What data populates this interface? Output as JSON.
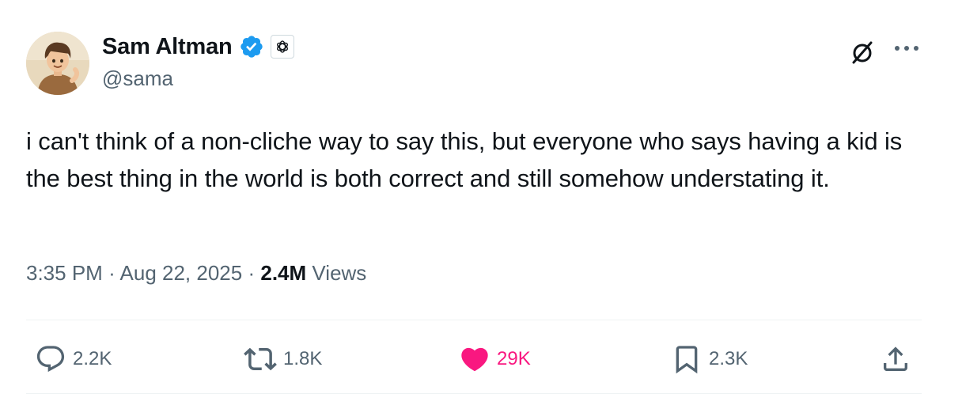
{
  "author": {
    "display_name": "Sam Altman",
    "handle": "@sama",
    "verified_icon": "verified-badge-icon",
    "affiliate_icon": "openai-logo-icon",
    "verified_color": "#1d9bf0"
  },
  "tweet": {
    "text": "i can't think of a non-cliche way to say this, but everyone who says having a kid is the best thing in the world is both correct and still somehow understating it.",
    "time": "3:35 PM",
    "separator": "·",
    "date": "Aug 22, 2025",
    "views_count": "2.4M",
    "views_label": "Views"
  },
  "actions": {
    "reply": {
      "icon": "reply-icon",
      "count": "2.2K"
    },
    "retweet": {
      "icon": "retweet-icon",
      "count": "1.8K"
    },
    "like": {
      "icon": "heart-icon",
      "count": "29K",
      "liked": true,
      "color": "#f91880"
    },
    "bookmark": {
      "icon": "bookmark-icon",
      "count": "2.3K"
    },
    "share": {
      "icon": "share-icon"
    }
  },
  "header_buttons": {
    "grok": "grok-icon",
    "more": "more-icon"
  },
  "colors": {
    "text_primary": "#0f1419",
    "text_secondary": "#536471",
    "divider": "#eff3f4",
    "like": "#f91880",
    "verified": "#1d9bf0"
  }
}
